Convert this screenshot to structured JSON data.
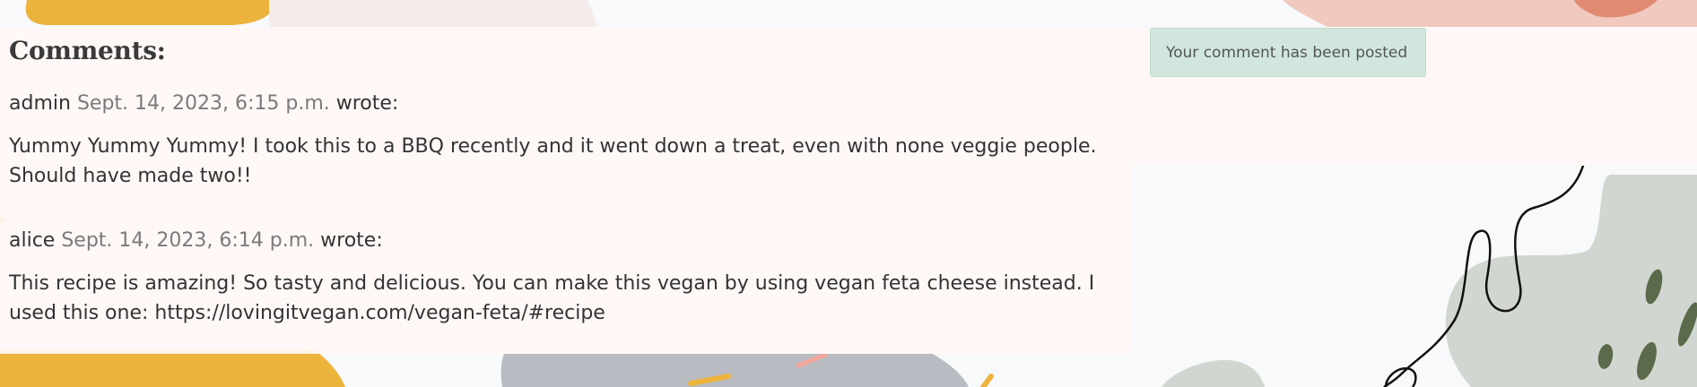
{
  "comments_section": {
    "heading": "Comments:",
    "comments": [
      {
        "author": "admin",
        "date": "Sept. 14, 2023, 6:15 p.m.",
        "wrote": "wrote:",
        "body": "Yummy Yummy Yummy! I took this to a BBQ recently and it went down a treat, even with none veggie people. Should have made two!!"
      },
      {
        "author": "alice",
        "date": "Sept. 14, 2023, 6:14 p.m.",
        "wrote": "wrote:",
        "body": "This recipe is amazing! So tasty and delicious. You can make this vegan by using vegan feta cheese instead. I used this one: https://lovingitvegan.com/vegan-feta/#recipe"
      }
    ]
  },
  "alert": {
    "message": "Your comment has been posted"
  },
  "colors": {
    "page_background": "#f7f9fb",
    "panel_background": "#fff8f6",
    "alert_background": "#d1e7dd",
    "mustard": "#ecb33d",
    "peach": "#f2c9bf",
    "slate": "#b8bcc2",
    "sage": "#d2d6d0",
    "leaf": "#5a6a4a"
  }
}
